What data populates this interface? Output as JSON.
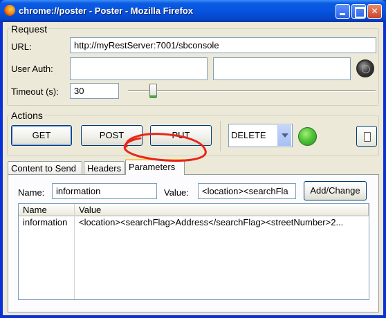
{
  "window": {
    "title": "chrome://poster - Poster - Mozilla Firefox"
  },
  "request": {
    "group_label": "Request",
    "url_label": "URL:",
    "url_value": "http://myRestServer:7001/sbconsole",
    "auth_label": "User Auth:",
    "auth_user": "",
    "auth_pass": "",
    "timeout_label": "Timeout (s):",
    "timeout_value": "30",
    "timeout_slider_fraction": 0.09
  },
  "actions": {
    "group_label": "Actions",
    "get": "GET",
    "post": "POST",
    "put": "PUT",
    "method_selected": "DELETE"
  },
  "tabs": [
    {
      "label": "Content to Send"
    },
    {
      "label": "Headers"
    },
    {
      "label": "Parameters"
    }
  ],
  "parameters": {
    "name_label": "Name:",
    "name_value": "information",
    "value_label": "Value:",
    "value_value": "<location><searchFla",
    "add_button": "Add/Change",
    "columns": [
      "Name",
      "Value"
    ],
    "rows": [
      {
        "name": "information",
        "value": "<location><searchFlag>Address</searchFlag><streetNumber>2..."
      }
    ]
  },
  "colors": {
    "annotation": "#e8251a",
    "titlebar": "#0754e0"
  }
}
